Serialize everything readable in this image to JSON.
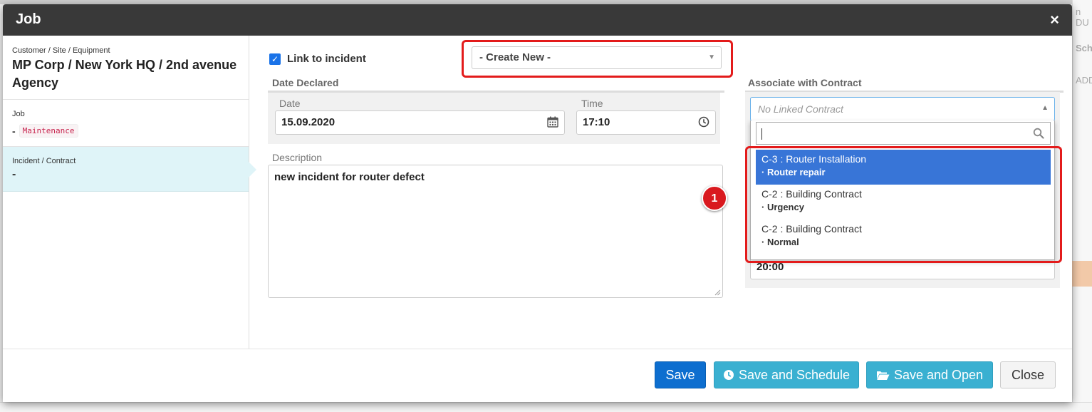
{
  "modal": {
    "title": "Job",
    "close": "×"
  },
  "left_panel": {
    "customer_caption": "Customer / Site / Equipment",
    "customer_value": "MP Corp / New York HQ / 2nd avenue Agency",
    "job_caption": "Job",
    "job_dash": "-",
    "job_badge": "Maintenance",
    "incident_caption": "Incident / Contract",
    "incident_value": "-"
  },
  "form": {
    "link_incident_label": "Link to incident",
    "link_incident_checked": true,
    "incident_select_value": "- Create New -",
    "date_declared_header": "Date Declared",
    "date_label": "Date",
    "date_value": "15.09.2020",
    "time_label": "Time",
    "time_value": "17:10",
    "description_label": "Description",
    "description_value": "new incident for router defect",
    "annotation_number": "1"
  },
  "contract": {
    "header": "Associate with Contract",
    "placeholder": "No Linked Contract",
    "search_value": "",
    "options": [
      {
        "title": "C-3 : Router Installation",
        "sub": "· Router repair",
        "selected": true
      },
      {
        "title": "C-2 : Building Contract",
        "sub": "· Urgency",
        "selected": false
      },
      {
        "title": "C-2 : Building Contract",
        "sub": "· Normal",
        "selected": false
      }
    ],
    "hidden_time_value": "20:00"
  },
  "footer": {
    "save": "Save",
    "save_schedule": "Save and Schedule",
    "save_open": "Save and Open",
    "close": "Close"
  },
  "background": {
    "right_text_1": "n DU",
    "right_text_2": "Sche",
    "right_text_3": "ADD"
  },
  "colors": {
    "primary": "#0d6ecf",
    "info": "#3ab0d1",
    "header": "#393939",
    "highlight": "#3875d7",
    "annotation": "#e31b1b"
  },
  "icons": {
    "close": "close-icon",
    "checkbox": "check-icon",
    "calendar": "calendar-icon",
    "clock": "clock-icon",
    "search": "search-icon",
    "schedule_btn": "clock-icon",
    "open_btn": "folder-open-icon"
  }
}
